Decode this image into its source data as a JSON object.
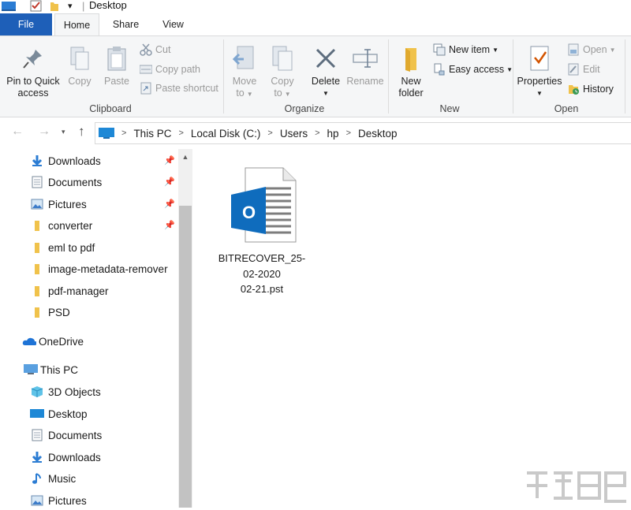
{
  "window": {
    "title": "Desktop",
    "qat_separator": "|"
  },
  "tabs": [
    "File",
    "Home",
    "Share",
    "View"
  ],
  "ribbon": {
    "clipboard": {
      "label": "Clipboard",
      "pin_line1": "Pin to Quick",
      "pin_line2": "access",
      "copy": "Copy",
      "paste": "Paste",
      "cut": "Cut",
      "copy_path": "Copy path",
      "paste_shortcut": "Paste shortcut"
    },
    "organize": {
      "label": "Organize",
      "move_line1": "Move",
      "move_line2": "to",
      "copy_line1": "Copy",
      "copy_line2": "to",
      "delete": "Delete",
      "rename": "Rename"
    },
    "new": {
      "label": "New",
      "new_folder_line1": "New",
      "new_folder_line2": "folder",
      "new_item": "New item",
      "easy_access": "Easy access"
    },
    "open": {
      "label": "Open",
      "properties": "Properties",
      "open": "Open",
      "edit": "Edit",
      "history": "History"
    }
  },
  "address": {
    "crumbs": [
      "This PC",
      "Local Disk (C:)",
      "Users",
      "hp",
      "Desktop"
    ]
  },
  "sidebar": {
    "quick_access": [
      {
        "label": "Downloads",
        "icon": "download-arrow-icon",
        "pinned": true
      },
      {
        "label": "Documents",
        "icon": "documents-icon",
        "pinned": true
      },
      {
        "label": "Pictures",
        "icon": "pictures-icon",
        "pinned": true
      },
      {
        "label": "converter",
        "icon": "folder-icon",
        "pinned": true
      },
      {
        "label": "eml to pdf",
        "icon": "folder-icon",
        "pinned": false
      },
      {
        "label": "image-metadata-remover",
        "icon": "folder-icon",
        "pinned": false
      },
      {
        "label": "pdf-manager",
        "icon": "folder-icon",
        "pinned": false
      },
      {
        "label": "PSD",
        "icon": "folder-icon",
        "pinned": false
      }
    ],
    "onedrive": "OneDrive",
    "this_pc": "This PC",
    "this_pc_items": [
      {
        "label": "3D Objects",
        "icon": "3d-objects-icon"
      },
      {
        "label": "Desktop",
        "icon": "desktop-icon"
      },
      {
        "label": "Documents",
        "icon": "documents-icon"
      },
      {
        "label": "Downloads",
        "icon": "download-arrow-icon"
      },
      {
        "label": "Music",
        "icon": "music-note-icon"
      },
      {
        "label": "Pictures",
        "icon": "pictures-icon"
      }
    ]
  },
  "files": [
    {
      "name_line1": "BITRECOVER_25-",
      "name_line2": "02-2020",
      "name_line3": "02-21.pst",
      "icon": "outlook-pst-file-icon"
    }
  ],
  "colors": {
    "file_tab": "#1e5fb8",
    "ribbon_bg": "#f5f6f7",
    "folder_yellow": "#f0c24b",
    "outlook_blue": "#0f6cbd"
  }
}
